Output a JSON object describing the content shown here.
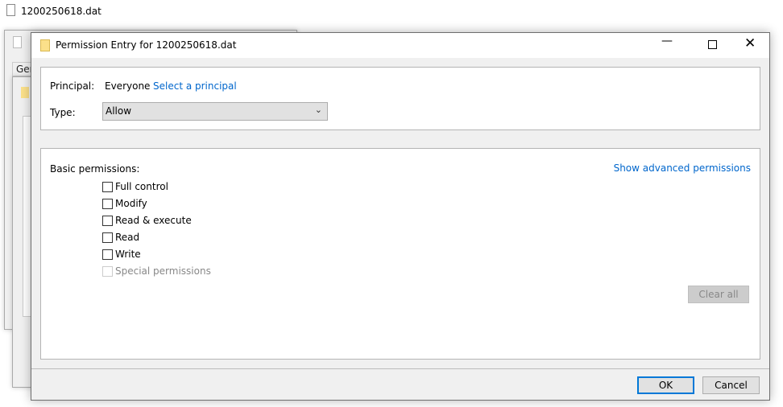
{
  "desktop": {
    "file_label": "1200250618.dat"
  },
  "background_window": {
    "tab_label": "Gen"
  },
  "dialog": {
    "title": "Permission Entry for 1200250618.dat",
    "principal_label": "Principal:",
    "principal_value": "Everyone",
    "select_principal_link": "Select a principal",
    "type_label": "Type:",
    "type_value": "Allow",
    "basic_permissions_label": "Basic permissions:",
    "show_advanced_link": "Show advanced permissions",
    "permissions": [
      {
        "label": "Full control",
        "checked": false,
        "enabled": true
      },
      {
        "label": "Modify",
        "checked": false,
        "enabled": true
      },
      {
        "label": "Read & execute",
        "checked": false,
        "enabled": true
      },
      {
        "label": "Read",
        "checked": false,
        "enabled": true
      },
      {
        "label": "Write",
        "checked": false,
        "enabled": true
      },
      {
        "label": "Special permissions",
        "checked": false,
        "enabled": false
      }
    ],
    "clear_all_label": "Clear all",
    "ok_label": "OK",
    "cancel_label": "Cancel"
  }
}
